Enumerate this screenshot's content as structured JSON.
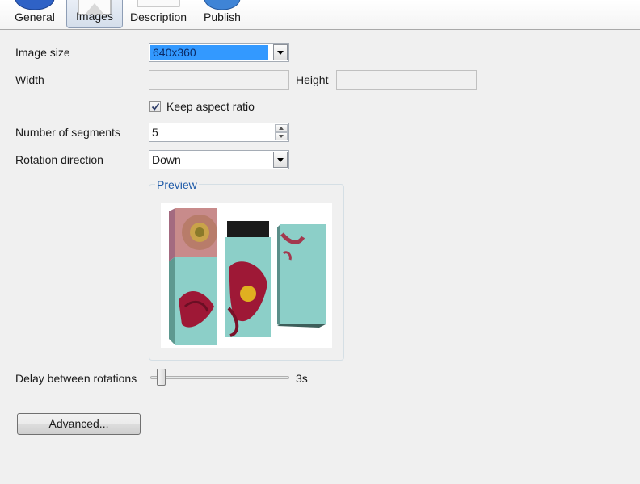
{
  "toolbar": {
    "items": [
      {
        "label": "General",
        "icon": "general-icon"
      },
      {
        "label": "Images",
        "icon": "images-icon",
        "active": true
      },
      {
        "label": "Description",
        "icon": "description-icon"
      },
      {
        "label": "Publish",
        "icon": "publish-icon"
      }
    ]
  },
  "form": {
    "image_size": {
      "label": "Image size",
      "value": "640x360"
    },
    "width": {
      "label": "Width",
      "value": ""
    },
    "height": {
      "label": "Height",
      "value": ""
    },
    "keep_aspect": {
      "label": "Keep aspect ratio",
      "checked": true
    },
    "segments": {
      "label": "Number of segments",
      "value": "5"
    },
    "rotation": {
      "label": "Rotation direction",
      "value": "Down"
    },
    "preview": {
      "title": "Preview"
    },
    "delay": {
      "label": "Delay between rotations",
      "value": "3s",
      "position": 0.05
    },
    "advanced": {
      "label": "Advanced..."
    }
  },
  "colors": {
    "accent": "#3399ff",
    "group_title": "#1e5aa8",
    "teal": "#8ccfc8",
    "flower_red": "#9e1836"
  }
}
